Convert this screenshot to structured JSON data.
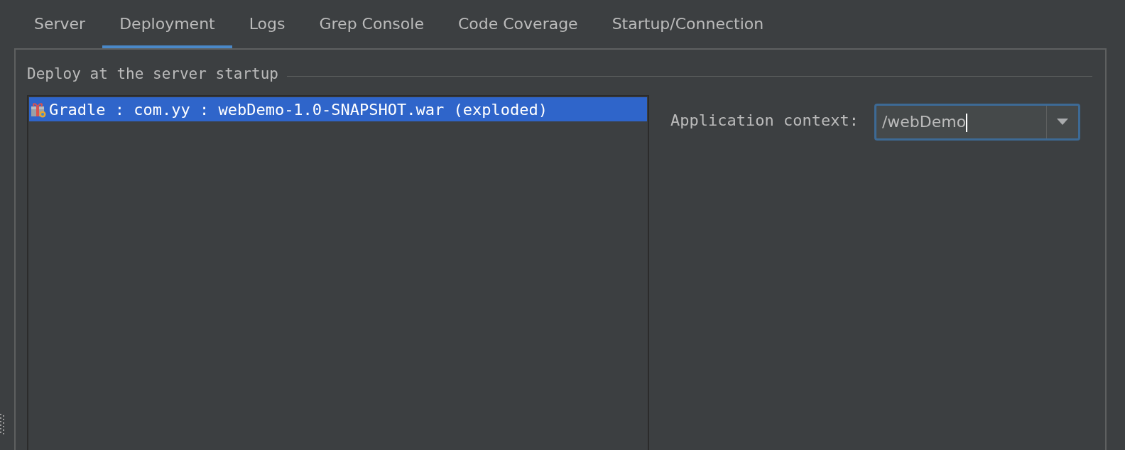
{
  "tabs": [
    {
      "label": "Server",
      "selected": false
    },
    {
      "label": "Deployment",
      "selected": true
    },
    {
      "label": "Logs",
      "selected": false
    },
    {
      "label": "Grep Console",
      "selected": false
    },
    {
      "label": "Code Coverage",
      "selected": false
    },
    {
      "label": "Startup/Connection",
      "selected": false
    }
  ],
  "deploy_group": {
    "title": "Deploy at the server startup",
    "artifacts": [
      {
        "label": "Gradle : com.yy : webDemo-1.0-SNAPSHOT.war (exploded)",
        "selected": true
      }
    ]
  },
  "application_context": {
    "label": "Application context:",
    "value": "/webDemo"
  }
}
